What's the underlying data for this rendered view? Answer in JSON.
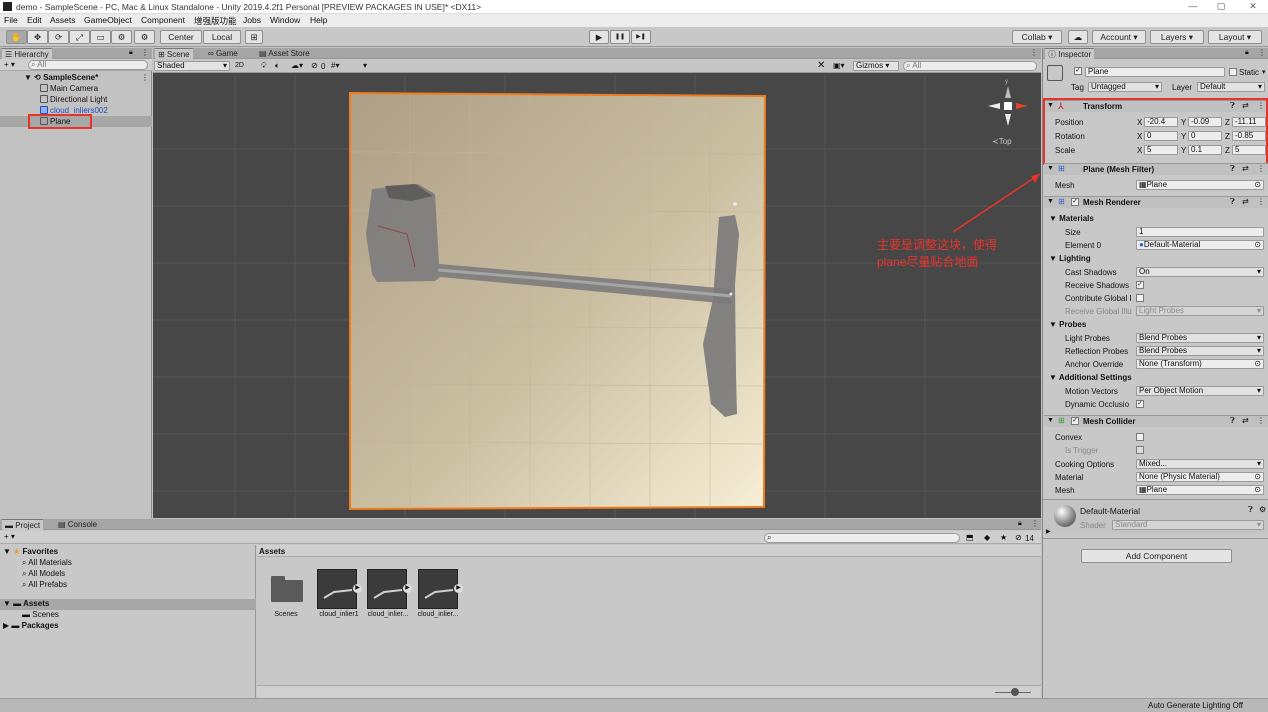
{
  "window": {
    "title": "demo - SampleScene - PC, Mac & Linux Standalone - Unity 2019.4.2f1 Personal [PREVIEW PACKAGES IN USE]* <DX11>",
    "minimize": "—",
    "maximize": "▢",
    "close": "✕"
  },
  "menu": [
    "File",
    "Edit",
    "Assets",
    "GameObject",
    "Component",
    "增强版功能",
    "Jobs",
    "Window",
    "Help"
  ],
  "toolbar": {
    "tools": [
      "✋",
      "✥",
      "⟳",
      "⤢",
      "▭",
      "⚙"
    ],
    "pivot_center": "Center",
    "pivot_local": "Local",
    "snap": "⊞",
    "play": "▶",
    "pause": "❚❚",
    "step": "▶❚",
    "collab": "Collab ▾",
    "cloud": "☁",
    "account": "Account ▾",
    "layers": "Layers ▾",
    "layout": "Layout ▾"
  },
  "hierarchy": {
    "tab": "Hierarchy",
    "create": "+ ▾",
    "search_placeholder": "All",
    "scene": "SampleScene*",
    "items": [
      {
        "label": "Main Camera",
        "color": "#111111"
      },
      {
        "label": "Directional Light",
        "color": "#111111"
      },
      {
        "label": "cloud_inliers002",
        "color": "#1a4fbf"
      },
      {
        "label": "Plane",
        "color": "#111111"
      }
    ]
  },
  "scene_view": {
    "tabs": [
      "Scene",
      "Game",
      "Asset Store"
    ],
    "shading": "Shaded",
    "mode_2d": "2D",
    "fx_count": "0",
    "gizmos": "Gizmos",
    "search_placeholder": "All",
    "gizmo_label": "≺Top",
    "annotation": [
      "主要是调整这块，使得",
      "plane尽量贴合地面"
    ],
    "annotation_color": "#e8332a"
  },
  "project": {
    "tabs": [
      "Project",
      "Console"
    ],
    "create": "+ ▾",
    "favorites_title": "Favorites",
    "favorites": [
      "All Materials",
      "All Models",
      "All Prefabs"
    ],
    "assets_title": "Assets",
    "assets_children": [
      "Scenes"
    ],
    "packages": "Packages",
    "header": "Assets",
    "hidden_count": "14",
    "items": [
      "Scenes",
      "cloud_inlier1",
      "cloud_inlier...",
      "cloud_inlier..."
    ]
  },
  "inspector": {
    "tab": "Inspector",
    "object_name": "Plane",
    "static": "Static",
    "tag_label": "Tag",
    "tag": "Untagged",
    "layer_label": "Layer",
    "layer": "Default",
    "transform": {
      "title": "Transform",
      "position_label": "Position",
      "rotation_label": "Rotation",
      "scale_label": "Scale",
      "axes": [
        "X",
        "Y",
        "Z"
      ],
      "position": [
        "-20.4",
        "-0.09",
        "-11.11"
      ],
      "rotation": [
        "0",
        "0",
        "-0.85"
      ],
      "scale": [
        "5",
        "0.1",
        "5"
      ]
    },
    "mesh_filter": {
      "title": "Plane (Mesh Filter)",
      "mesh_label": "Mesh",
      "mesh": "Plane"
    },
    "mesh_renderer": {
      "title": "Mesh Renderer",
      "materials": "Materials",
      "size_label": "Size",
      "size": "1",
      "element0_label": "Element 0",
      "element0": "Default-Material",
      "lighting": "Lighting",
      "cast_shadows_label": "Cast Shadows",
      "cast_shadows": "On",
      "receive_shadows_label": "Receive Shadows",
      "contribute_gi_label": "Contribute Global I",
      "receive_gi_label": "Receive Global Illu",
      "receive_gi": "Light Probes",
      "probes": "Probes",
      "light_probes_label": "Light Probes",
      "light_probes": "Blend Probes",
      "reflection_probes_label": "Reflection Probes",
      "reflection_probes": "Blend Probes",
      "anchor_override_label": "Anchor Override",
      "anchor_override": "None (Transform)",
      "additional": "Additional Settings",
      "motion_vectors_label": "Motion Vectors",
      "motion_vectors": "Per Object Motion",
      "dynamic_occlusion_label": "Dynamic Occlusio"
    },
    "mesh_collider": {
      "title": "Mesh Collider",
      "convex_label": "Convex",
      "is_trigger_label": "Is Trigger",
      "cooking_label": "Cooking Options",
      "cooking": "Mixed...",
      "material_label": "Material",
      "material": "None (Physic Material)",
      "mesh_label": "Mesh",
      "mesh": "Plane"
    },
    "material": {
      "name": "Default-Material",
      "shader_label": "Shader",
      "shader": "Standard"
    },
    "add_component": "Add Component"
  },
  "status": {
    "right": "Auto Generate Lighting Off"
  }
}
